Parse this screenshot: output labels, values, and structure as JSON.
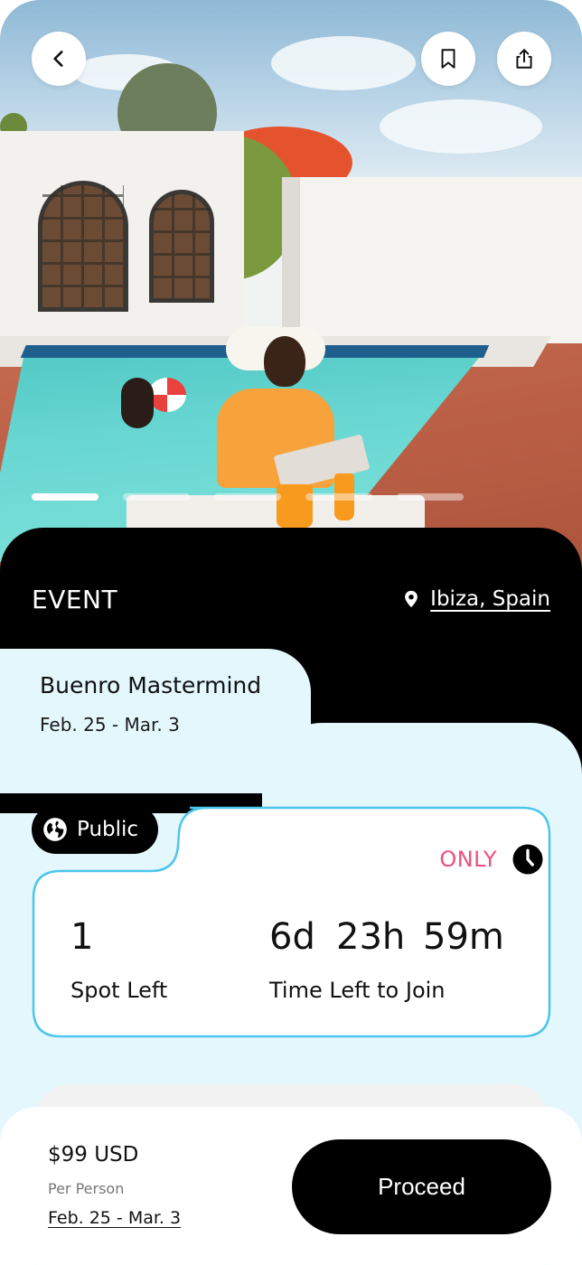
{
  "header": {
    "back_icon": "chevron-left-icon",
    "bookmark_icon": "bookmark-icon",
    "share_icon": "share-icon",
    "carousel": {
      "count": 5,
      "active_index": 0
    }
  },
  "event": {
    "category": "EVENT",
    "location": "Ibiza, Spain",
    "location_icon": "map-pin-icon",
    "name": "Buenro Mastermind",
    "dates": "Feb. 25 - Mar. 3"
  },
  "visibility": {
    "label": "Public",
    "icon": "globe-icon"
  },
  "availability": {
    "only_label": "ONLY",
    "clock_icon": "clock-icon",
    "spots_value": "1",
    "spots_label": "Spot Left",
    "time_days": "6d",
    "time_hours": "23h",
    "time_minutes": "59m",
    "time_label": "Time Left to Join"
  },
  "footer": {
    "price": "$99 USD",
    "per_person": "Per Person",
    "dates": "Feb. 25 - Mar. 3",
    "proceed_label": "Proceed"
  },
  "colors": {
    "accent_pink": "#ef4f7f",
    "card_border": "#4cc6ea",
    "panel_light": "#e4f7fd",
    "dark": "#000000"
  }
}
